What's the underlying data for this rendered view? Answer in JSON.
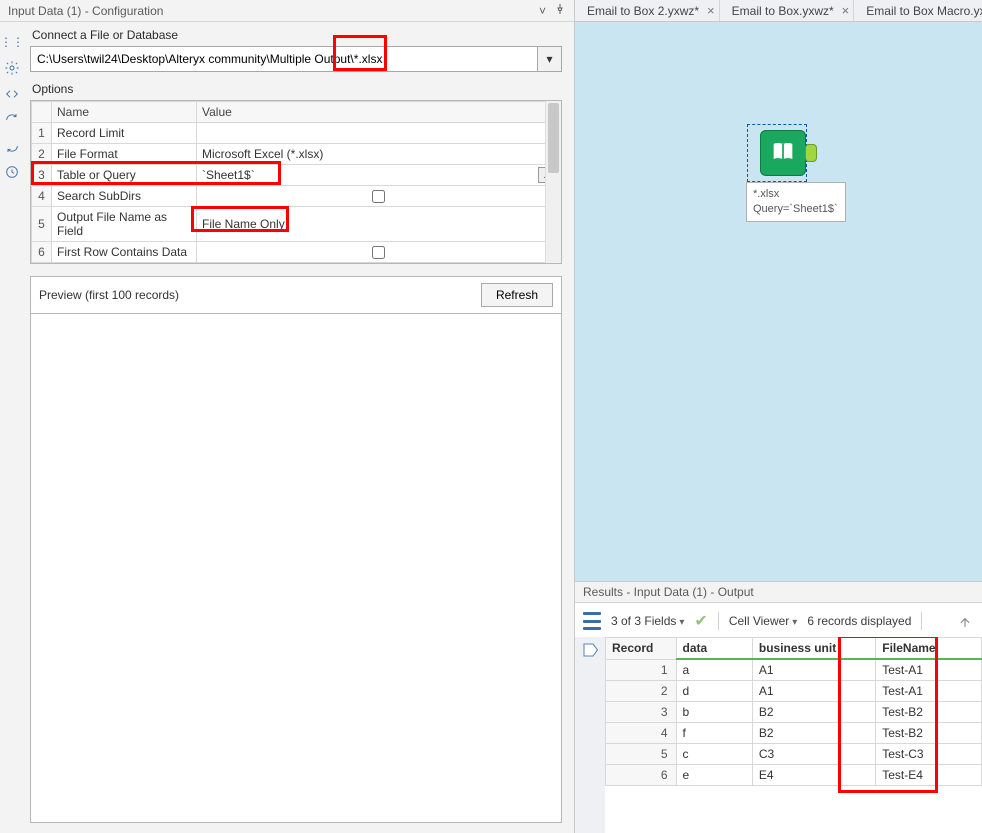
{
  "left": {
    "title": "Input Data (1) - Configuration",
    "connect_label": "Connect a File or Database",
    "path": "C:\\Users\\twil24\\Desktop\\Alteryx community\\Multiple Output\\*.xlsx",
    "options_label": "Options",
    "cols": {
      "name": "Name",
      "value": "Value"
    },
    "rows": [
      {
        "n": "1",
        "name": "Record Limit",
        "value": ""
      },
      {
        "n": "2",
        "name": "File Format",
        "value": "Microsoft Excel (*.xlsx)"
      },
      {
        "n": "3",
        "name": "Table or Query",
        "value": "`Sheet1$`"
      },
      {
        "n": "4",
        "name": "Search SubDirs",
        "value": ""
      },
      {
        "n": "5",
        "name": "Output File Name as Field",
        "value": "File Name Only"
      },
      {
        "n": "6",
        "name": "First Row Contains Data",
        "value": ""
      }
    ],
    "preview_label": "Preview (first 100 records)",
    "refresh": "Refresh"
  },
  "tabs": [
    {
      "label": "Email to Box 2.yxwz*",
      "closeable": true
    },
    {
      "label": "Email to Box.yxwz*",
      "closeable": true
    },
    {
      "label": "Email to Box Macro.yx",
      "closeable": false
    }
  ],
  "canvas": {
    "tool_label_line1": "*.xlsx",
    "tool_label_line2": "Query=`Sheet1$`"
  },
  "results": {
    "title": "Results - Input Data (1) - Output",
    "fields_text": "3 of 3 Fields",
    "cell_viewer": "Cell Viewer",
    "records_disp": "6 records displayed",
    "headers": {
      "rec": "Record",
      "data": "data",
      "bu": "business unit",
      "fn": "FileName"
    },
    "rows": [
      {
        "n": "1",
        "data": "a",
        "bu": "A1",
        "fn": "Test-A1"
      },
      {
        "n": "2",
        "data": "d",
        "bu": "A1",
        "fn": "Test-A1"
      },
      {
        "n": "3",
        "data": "b",
        "bu": "B2",
        "fn": "Test-B2"
      },
      {
        "n": "4",
        "data": "f",
        "bu": "B2",
        "fn": "Test-B2"
      },
      {
        "n": "5",
        "data": "c",
        "bu": "C3",
        "fn": "Test-C3"
      },
      {
        "n": "6",
        "data": "e",
        "bu": "E4",
        "fn": "Test-E4"
      }
    ]
  }
}
